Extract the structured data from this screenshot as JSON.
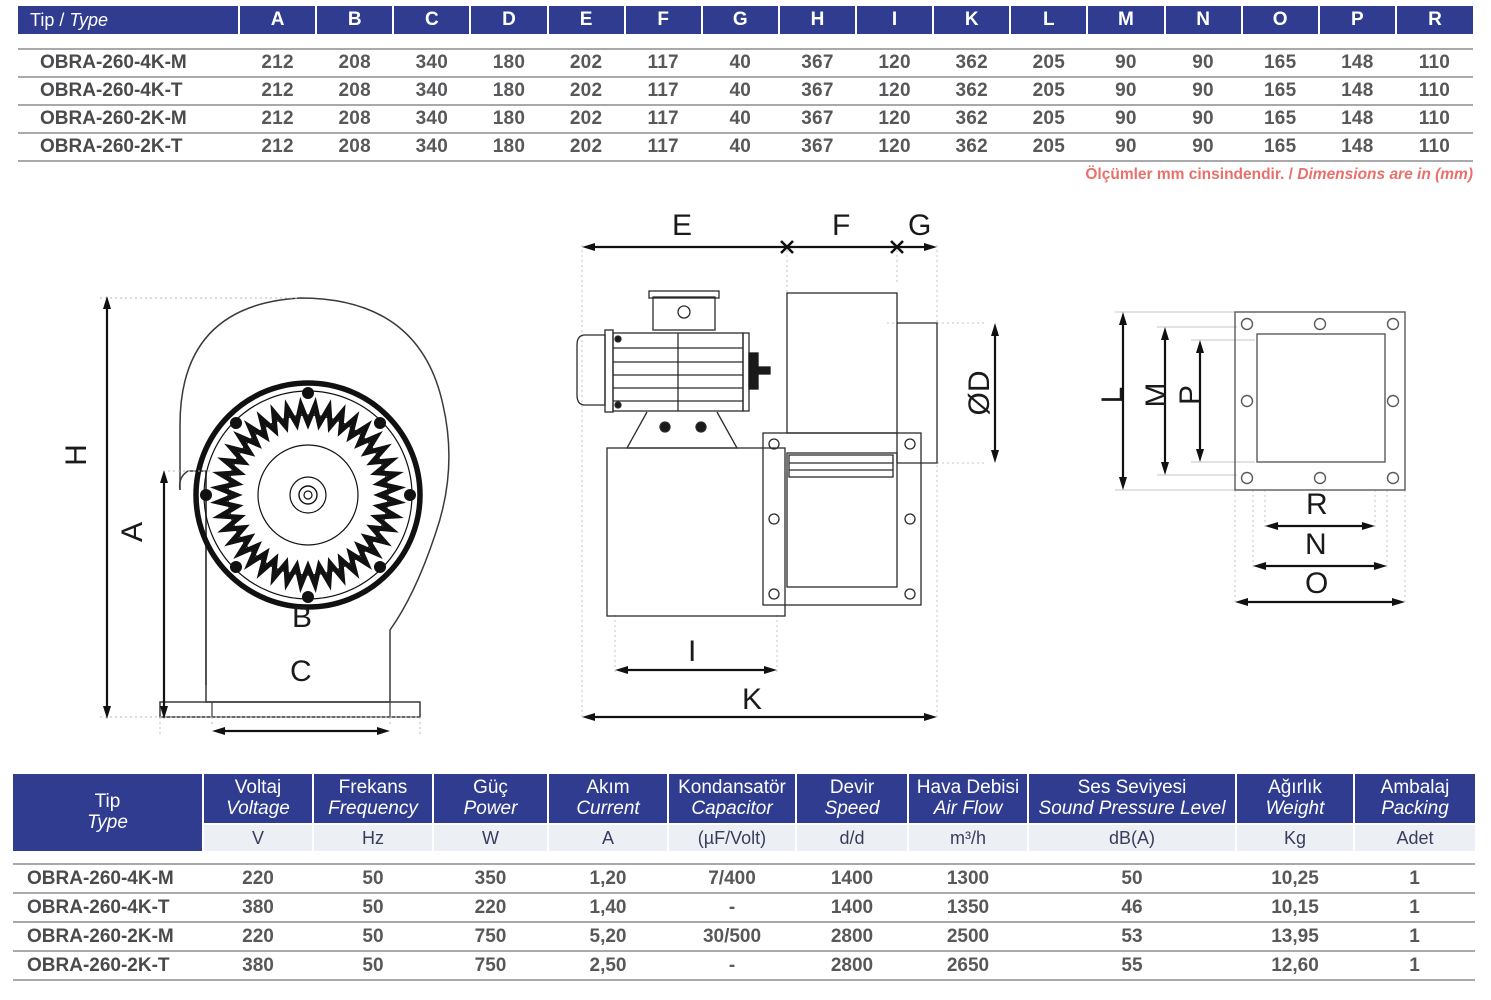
{
  "dimension_table": {
    "headers": [
      "Tip / Type",
      "A",
      "B",
      "C",
      "D",
      "E",
      "F",
      "G",
      "H",
      "I",
      "K",
      "L",
      "M",
      "N",
      "O",
      "P",
      "R"
    ],
    "type_header_tr": "Tip",
    "type_header_sep": " / ",
    "type_header_en": "Type",
    "rows": [
      {
        "type": "OBRA-260-4K-M",
        "A": "212",
        "B": "208",
        "C": "340",
        "D": "180",
        "E": "202",
        "F": "117",
        "G": "40",
        "H": "367",
        "I": "120",
        "K": "362",
        "L": "205",
        "M": "90",
        "N": "90",
        "O": "165",
        "P": "148",
        "R": "110"
      },
      {
        "type": "OBRA-260-4K-T",
        "A": "212",
        "B": "208",
        "C": "340",
        "D": "180",
        "E": "202",
        "F": "117",
        "G": "40",
        "H": "367",
        "I": "120",
        "K": "362",
        "L": "205",
        "M": "90",
        "N": "90",
        "O": "165",
        "P": "148",
        "R": "110"
      },
      {
        "type": "OBRA-260-2K-M",
        "A": "212",
        "B": "208",
        "C": "340",
        "D": "180",
        "E": "202",
        "F": "117",
        "G": "40",
        "H": "367",
        "I": "120",
        "K": "362",
        "L": "205",
        "M": "90",
        "N": "90",
        "O": "165",
        "P": "148",
        "R": "110"
      },
      {
        "type": "OBRA-260-2K-T",
        "A": "212",
        "B": "208",
        "C": "340",
        "D": "180",
        "E": "202",
        "F": "117",
        "G": "40",
        "H": "367",
        "I": "120",
        "K": "362",
        "L": "205",
        "M": "90",
        "N": "90",
        "O": "165",
        "P": "148",
        "R": "110"
      }
    ]
  },
  "units_note": {
    "tr": "Ölçümler mm cinsindendir.",
    "sep": " / ",
    "en": "Dimensions are in (mm)",
    "color": "#e8706a"
  },
  "drawings": {
    "front_view": {
      "name": "centrifugal-fan-front-view",
      "labels": [
        "H",
        "A",
        "B",
        "C"
      ]
    },
    "side_view": {
      "name": "centrifugal-fan-side-view",
      "labels": [
        "E",
        "F",
        "G",
        "ØD",
        "I",
        "K"
      ]
    },
    "flange_view": {
      "name": "outlet-flange-view",
      "labels": [
        "L",
        "M",
        "P",
        "R",
        "N",
        "O"
      ]
    },
    "label_H": "H",
    "label_A": "A",
    "label_B": "B",
    "label_C": "C",
    "label_E": "E",
    "label_F": "F",
    "label_G": "G",
    "label_D": "ØD",
    "label_I": "I",
    "label_K": "K",
    "label_L": "L",
    "label_M": "M",
    "label_P": "P",
    "label_R": "R",
    "label_N": "N",
    "label_O": "O"
  },
  "spec_table": {
    "columns": [
      {
        "tr": "Tip",
        "en": "Type",
        "unit": ""
      },
      {
        "tr": "Voltaj",
        "en": "Voltage",
        "unit": "V"
      },
      {
        "tr": "Frekans",
        "en": "Frequency",
        "unit": "Hz"
      },
      {
        "tr": "Güç",
        "en": "Power",
        "unit": "W"
      },
      {
        "tr": "Akım",
        "en": "Current",
        "unit": "A"
      },
      {
        "tr": "Kondansatör",
        "en": "Capacitor",
        "unit": "(µF/Volt)"
      },
      {
        "tr": "Devir",
        "en": "Speed",
        "unit": "d/d"
      },
      {
        "tr": "Hava Debisi",
        "en": "Air Flow",
        "unit": "m³/h"
      },
      {
        "tr": "Ses Seviyesi",
        "en": "Sound Pressure Level",
        "unit": "dB(A)"
      },
      {
        "tr": "Ağırlık",
        "en": "Weight",
        "unit": "Kg"
      },
      {
        "tr": "Ambalaj",
        "en": "Packing",
        "unit": "Adet"
      }
    ],
    "rows": [
      {
        "type": "OBRA-260-4K-M",
        "voltage": "220",
        "frequency": "50",
        "power": "350",
        "current": "1,20",
        "capacitor": "7/400",
        "speed": "1400",
        "airflow": "1300",
        "sound": "50",
        "weight": "10,25",
        "packing": "1"
      },
      {
        "type": "OBRA-260-4K-T",
        "voltage": "380",
        "frequency": "50",
        "power": "220",
        "current": "1,40",
        "capacitor": "-",
        "speed": "1400",
        "airflow": "1350",
        "sound": "46",
        "weight": "10,15",
        "packing": "1"
      },
      {
        "type": "OBRA-260-2K-M",
        "voltage": "220",
        "frequency": "50",
        "power": "750",
        "current": "5,20",
        "capacitor": "30/500",
        "speed": "2800",
        "airflow": "2500",
        "sound": "53",
        "weight": "13,95",
        "packing": "1"
      },
      {
        "type": "OBRA-260-2K-T",
        "voltage": "380",
        "frequency": "50",
        "power": "750",
        "current": "2,50",
        "capacitor": "-",
        "speed": "2800",
        "airflow": "2650",
        "sound": "55",
        "weight": "12,60",
        "packing": "1"
      }
    ]
  },
  "colors": {
    "header_blue": "#2f3c8f",
    "unit_row_bg": "#eceff3",
    "rule_gray": "#a9a9ac",
    "text_gray": "#58585a",
    "note_red": "#e8706a"
  }
}
